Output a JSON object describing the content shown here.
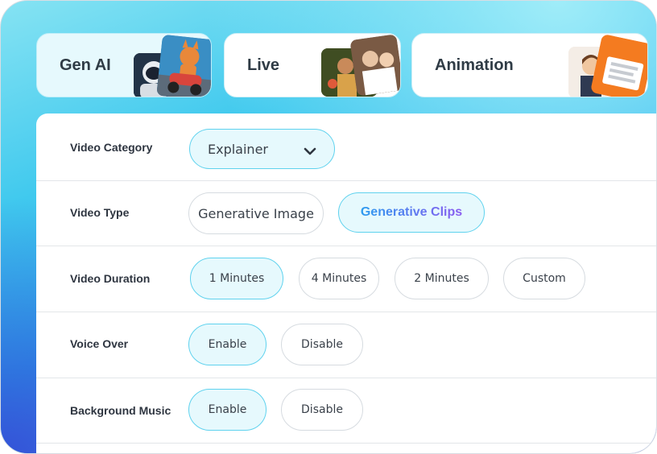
{
  "tabs": [
    {
      "title": "Gen AI",
      "active": true
    },
    {
      "title": "Live",
      "active": false
    },
    {
      "title": "Animation",
      "active": false
    }
  ],
  "form": {
    "video_category": {
      "label": "Video Category",
      "value": "Explainer",
      "icon": "chevron-down-icon"
    },
    "video_type": {
      "label": "Video Type",
      "options": [
        "Generative Image",
        "Generative Clips"
      ],
      "selected": "Generative Clips"
    },
    "video_duration": {
      "label": "Video Duration",
      "options": [
        "1 Minutes",
        "4 Minutes",
        "2 Minutes",
        "Custom"
      ],
      "selected": "1 Minutes"
    },
    "voice_over": {
      "label": "Voice Over",
      "options": [
        "Enable",
        "Disable"
      ],
      "selected": "Enable"
    },
    "background_music": {
      "label": "Background Music",
      "options": [
        "Enable",
        "Disable"
      ],
      "selected": "Enable"
    }
  },
  "colors": {
    "accent": "#5fd2ee",
    "selected_bg": "#e6f9fd",
    "gradient_start": "#2e9bef",
    "gradient_end": "#8a5cf0"
  }
}
